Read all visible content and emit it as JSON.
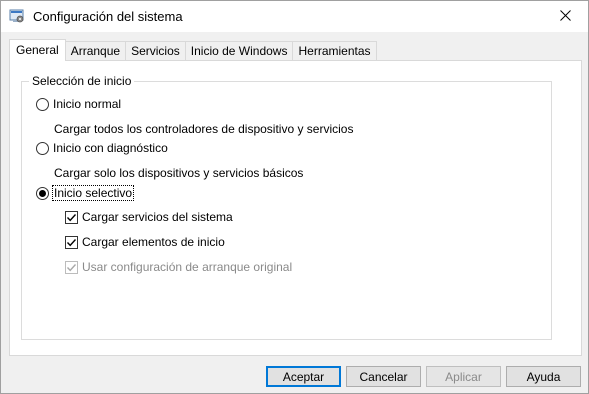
{
  "window": {
    "title": "Configuración del sistema",
    "accent_color": "#0078d7"
  },
  "tabs": [
    {
      "label": "General",
      "active": true
    },
    {
      "label": "Arranque",
      "active": false
    },
    {
      "label": "Servicios",
      "active": false
    },
    {
      "label": "Inicio de Windows",
      "active": false
    },
    {
      "label": "Herramientas",
      "active": false
    }
  ],
  "startup_selection": {
    "group_label": "Selección de inicio",
    "normal": {
      "label": "Inicio normal",
      "description": "Cargar todos los controladores de dispositivo y servicios",
      "selected": false
    },
    "diagnostic": {
      "label": "Inicio con diagnóstico",
      "description": "Cargar solo los dispositivos y servicios básicos",
      "selected": false
    },
    "selective": {
      "label": "Inicio selectivo",
      "selected": true,
      "options": {
        "load_services": {
          "label": "Cargar servicios del sistema",
          "checked": true,
          "enabled": true
        },
        "load_startup_items": {
          "label": "Cargar elementos de inicio",
          "checked": true,
          "enabled": true
        },
        "use_original_boot": {
          "label": "Usar configuración de arranque original",
          "checked": true,
          "enabled": false
        }
      }
    }
  },
  "buttons": {
    "ok": "Aceptar",
    "cancel": "Cancelar",
    "apply": "Aplicar",
    "help": "Ayuda"
  },
  "icons": {
    "app": "system-config-icon",
    "close": "close-icon"
  }
}
